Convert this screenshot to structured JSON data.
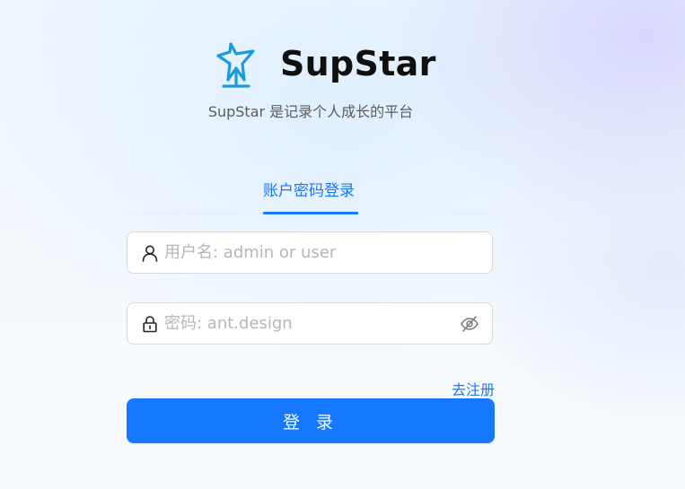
{
  "brand": {
    "name": "SupStar",
    "tagline": "SupStar 是记录个人成长的平台",
    "logo_icon": "star-trophy-icon",
    "logo_color": "#1a9be0"
  },
  "tabs": [
    {
      "label": "账户密码登录",
      "active": true
    }
  ],
  "form": {
    "username": {
      "value": "",
      "placeholder": "用户名: admin or user",
      "icon": "user-icon"
    },
    "password": {
      "value": "",
      "placeholder": "密码: ant.design",
      "icon": "lock-icon",
      "toggle_icon": "eye-invisible-icon"
    },
    "register_link": "去注册",
    "submit_label": "登 录"
  },
  "colors": {
    "primary": "#1677ff",
    "title": "#0f0f0f",
    "subtitle": "#5c5c5c",
    "placeholder": "#b6b6b6"
  }
}
